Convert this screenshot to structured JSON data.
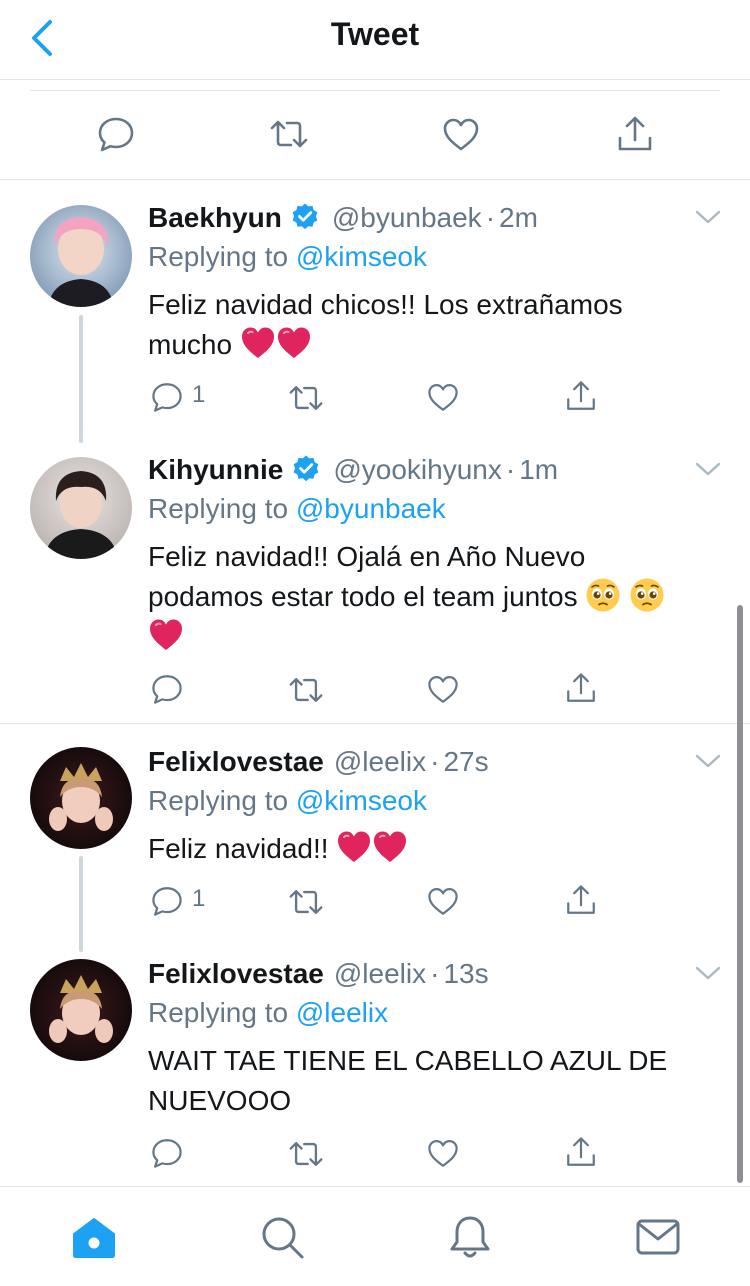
{
  "header": {
    "title": "Tweet",
    "back_icon": "chevron-left-icon"
  },
  "colors": {
    "accent": "#1da1f2",
    "text": "#14171a",
    "secondary": "#657786",
    "divider": "#e1e8ed",
    "heart": "#e0245e"
  },
  "main_tweet_actions": [
    {
      "icon": "reply-icon"
    },
    {
      "icon": "retweet-icon"
    },
    {
      "icon": "like-icon"
    },
    {
      "icon": "share-icon"
    }
  ],
  "replies": [
    {
      "name": "Baekhyun",
      "verified": true,
      "handle": "@byunbaek",
      "separator": "·",
      "time": "2m",
      "replying_label": "Replying to",
      "replying_to": "@kimseok",
      "text_line1": "Feliz navidad chicos!! Los extrañamos",
      "text_line2": "mucho",
      "emojis": [
        "red-heart",
        "red-heart"
      ],
      "reply_count": "1"
    },
    {
      "name": "Kihyunnie",
      "verified": true,
      "handle": "@yookihyunx",
      "separator": "·",
      "time": "1m",
      "replying_label": "Replying to",
      "replying_to": "@byunbaek",
      "text_line1": "Feliz navidad!! Ojalá en Año Nuevo",
      "text_line2": "podamos estar todo el team juntos",
      "emojis": [
        "pleading-face",
        "pleading-face",
        "red-heart"
      ],
      "reply_count": ""
    },
    {
      "name": "Felixlovestae",
      "verified": false,
      "handle": "@leelix",
      "separator": "·",
      "time": "27s",
      "replying_label": "Replying to",
      "replying_to": "@kimseok",
      "text_line1": "Feliz navidad!!",
      "emojis": [
        "red-heart",
        "red-heart"
      ],
      "reply_count": "1"
    },
    {
      "name": "Felixlovestae",
      "verified": false,
      "handle": "@leelix",
      "separator": "·",
      "time": "13s",
      "replying_label": "Replying to",
      "replying_to": "@leelix",
      "text_line1": "WAIT TAE TIENE EL CABELLO AZUL DE",
      "text_line2": "NUEVOOO",
      "emojis": [],
      "reply_count": ""
    }
  ],
  "tabbar": [
    {
      "icon": "home-icon",
      "active": true
    },
    {
      "icon": "search-icon",
      "active": false
    },
    {
      "icon": "notifications-icon",
      "active": false
    },
    {
      "icon": "messages-icon",
      "active": false
    }
  ]
}
